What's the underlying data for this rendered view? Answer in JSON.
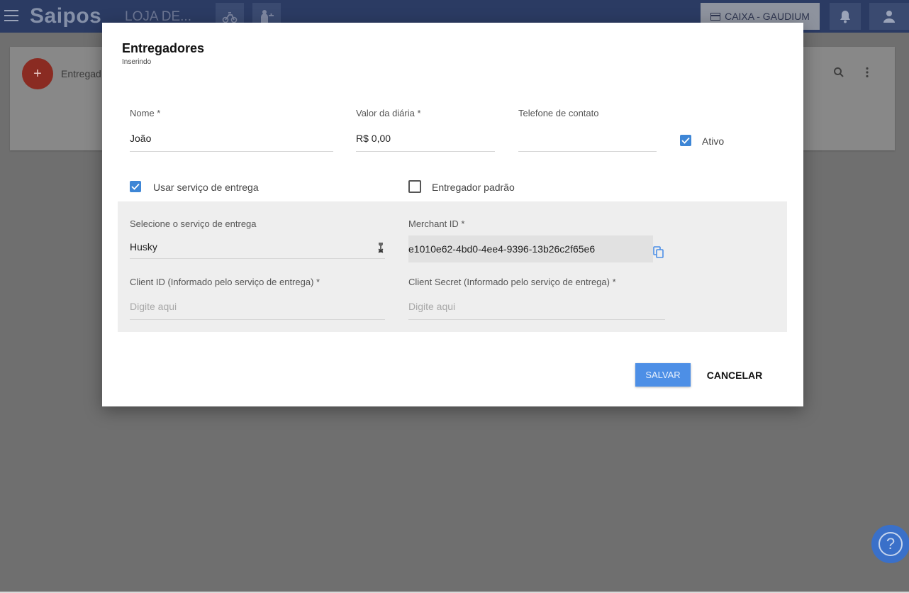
{
  "topbar": {
    "logo": "Saipos",
    "store_name": "LOJA DE...",
    "caixa_label": "CAIXA - GAUDIUM",
    "icons": [
      "menu-icon",
      "delivery-bike-icon",
      "waiter-icon",
      "cash-register-icon",
      "bell-icon",
      "user-icon"
    ]
  },
  "background_page": {
    "fab_icon": "+",
    "list_title": "Entregad"
  },
  "modal": {
    "title": "Entregadores",
    "subtitle": "Inserindo",
    "fields": {
      "nome": {
        "label": "Nome *",
        "value": "João"
      },
      "valor_diaria": {
        "label": "Valor da diária *",
        "value": "R$ 0,00"
      },
      "telefone": {
        "label": "Telefone de contato",
        "value": ""
      },
      "ativo": {
        "label": "Ativo",
        "checked": true
      }
    },
    "checkboxes": {
      "usar_servico": {
        "label": "Usar serviço de entrega",
        "checked": true
      },
      "entregador_padrao": {
        "label": "Entregador padrão",
        "checked": false
      }
    },
    "delivery_service": {
      "service": {
        "label": "Selecione o serviço de entrega",
        "value": "Husky"
      },
      "merchant_id": {
        "label": "Merchant ID *",
        "value": "e1010e62-4bd0-4ee4-9396-13b26c2f65e6"
      },
      "client_id": {
        "label": "Client ID (Informado pelo serviço de entrega) *",
        "placeholder": "Digite aqui"
      },
      "client_secret": {
        "label": "Client Secret (Informado pelo serviço de entrega) *",
        "placeholder": "Digite aqui"
      }
    },
    "actions": {
      "save": "SALVAR",
      "cancel": "CANCELAR"
    }
  },
  "help": {
    "glyph": "?"
  },
  "colors": {
    "topbar": "#2b3b63",
    "accent_blue": "#4d8fe6",
    "checkbox_blue": "#3e86d6",
    "fab_red": "#8a2b22",
    "gray_section": "#eeeeee"
  }
}
